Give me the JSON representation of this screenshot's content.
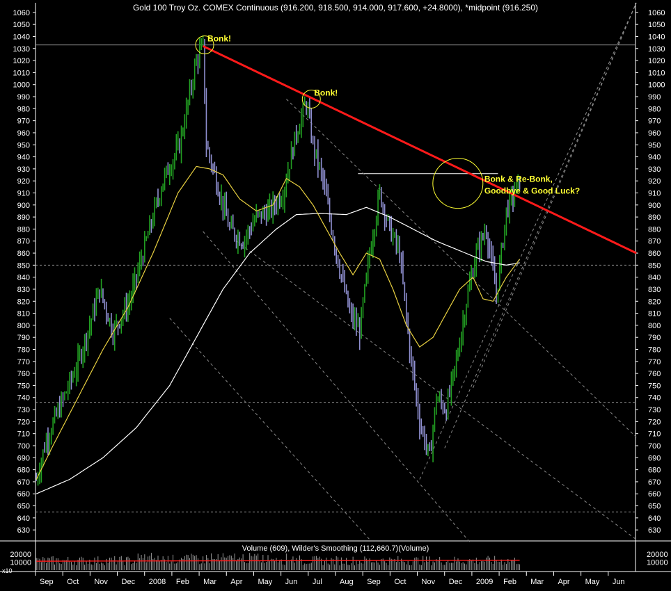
{
  "header": {
    "title": "Gold 100 Troy Oz. COMEX Continuous (916.200, 918.500, 914.000, 917.600, +24.8000), *midpoint (916.250)"
  },
  "colors": {
    "background": "#000000",
    "axis": "#ffffff",
    "up_bar": "#22a022",
    "down_bar": "#8f8fd0",
    "fast_ma": "#e8d040",
    "slow_ma": "#ffffff",
    "resistance": "#ff1a1a",
    "annotation": "#ffff33",
    "dashed": "#8a8a8a"
  },
  "chart_data": {
    "type": "bar",
    "title": "Gold 100 Troy Oz. COMEX Continuous (916.200, 918.500, 914.000, 917.600, +24.8000), *midpoint (916.250)",
    "ylim": [
      622,
      1068
    ],
    "y_ticks": [
      630,
      640,
      650,
      660,
      670,
      680,
      690,
      700,
      710,
      720,
      730,
      740,
      750,
      760,
      770,
      780,
      790,
      800,
      810,
      820,
      830,
      840,
      850,
      860,
      870,
      880,
      890,
      900,
      910,
      920,
      930,
      940,
      950,
      960,
      970,
      980,
      990,
      1000,
      1010,
      1020,
      1030,
      1040,
      1050,
      1060
    ],
    "x_labels": [
      "Sep",
      "Oct",
      "Nov",
      "Dec",
      "2008",
      "Feb",
      "Mar",
      "Apr",
      "May",
      "Jun",
      "Jul",
      "Aug",
      "Sep",
      "Oct",
      "Nov",
      "Dec",
      "2009",
      "Feb",
      "Mar",
      "Apr",
      "May",
      "Jun"
    ],
    "price_anchors": [
      [
        0,
        672
      ],
      [
        6,
        705
      ],
      [
        15,
        735
      ],
      [
        24,
        765
      ],
      [
        32,
        800
      ],
      [
        38,
        830
      ],
      [
        46,
        795
      ],
      [
        56,
        820
      ],
      [
        66,
        870
      ],
      [
        76,
        920
      ],
      [
        86,
        950
      ],
      [
        96,
        1020
      ],
      [
        100,
        1032
      ],
      [
        102,
        950
      ],
      [
        108,
        920
      ],
      [
        116,
        880
      ],
      [
        124,
        870
      ],
      [
        132,
        890
      ],
      [
        140,
        895
      ],
      [
        148,
        910
      ],
      [
        156,
        960
      ],
      [
        162,
        985
      ],
      [
        166,
        950
      ],
      [
        172,
        920
      ],
      [
        180,
        860
      ],
      [
        188,
        810
      ],
      [
        194,
        795
      ],
      [
        200,
        860
      ],
      [
        206,
        910
      ],
      [
        212,
        880
      ],
      [
        218,
        860
      ],
      [
        224,
        780
      ],
      [
        230,
        720
      ],
      [
        236,
        690
      ],
      [
        240,
        740
      ],
      [
        246,
        730
      ],
      [
        252,
        770
      ],
      [
        258,
        820
      ],
      [
        264,
        860
      ],
      [
        270,
        880
      ],
      [
        276,
        825
      ],
      [
        282,
        895
      ],
      [
        290,
        920
      ]
    ],
    "fast_ma_anchors": [
      [
        0,
        672
      ],
      [
        10,
        700
      ],
      [
        25,
        740
      ],
      [
        40,
        780
      ],
      [
        55,
        815
      ],
      [
        70,
        860
      ],
      [
        85,
        910
      ],
      [
        96,
        932
      ],
      [
        104,
        930
      ],
      [
        112,
        925
      ],
      [
        122,
        905
      ],
      [
        132,
        895
      ],
      [
        142,
        900
      ],
      [
        150,
        922
      ],
      [
        158,
        915
      ],
      [
        166,
        900
      ],
      [
        174,
        880
      ],
      [
        182,
        860
      ],
      [
        190,
        842
      ],
      [
        198,
        860
      ],
      [
        206,
        855
      ],
      [
        214,
        830
      ],
      [
        222,
        800
      ],
      [
        230,
        782
      ],
      [
        238,
        790
      ],
      [
        246,
        810
      ],
      [
        254,
        830
      ],
      [
        262,
        840
      ],
      [
        268,
        822
      ],
      [
        274,
        820
      ],
      [
        282,
        840
      ],
      [
        290,
        855
      ]
    ],
    "slow_ma_anchors": [
      [
        0,
        660
      ],
      [
        20,
        672
      ],
      [
        40,
        690
      ],
      [
        60,
        715
      ],
      [
        80,
        750
      ],
      [
        96,
        790
      ],
      [
        112,
        830
      ],
      [
        128,
        860
      ],
      [
        144,
        880
      ],
      [
        156,
        892
      ],
      [
        170,
        893
      ],
      [
        186,
        892
      ],
      [
        198,
        898
      ],
      [
        212,
        890
      ],
      [
        226,
        880
      ],
      [
        240,
        870
      ],
      [
        254,
        862
      ],
      [
        270,
        853
      ],
      [
        282,
        850
      ],
      [
        290,
        852
      ]
    ],
    "resistance_line": [
      [
        100,
        1032
      ],
      [
        360,
        860
      ]
    ],
    "horizontal_lines": [
      1033,
      850,
      736,
      645
    ],
    "short_lines": [
      {
        "y": 926,
        "x0": 193,
        "x1": 277
      }
    ],
    "dashed_lines": [
      [
        [
          150,
          988
        ],
        [
          360,
          707
        ]
      ],
      [
        [
          100,
          878
        ],
        [
          260,
          620
        ]
      ],
      [
        [
          80,
          806
        ],
        [
          200,
          622
        ]
      ],
      [
        [
          120,
          870
        ],
        [
          360,
          622
        ]
      ],
      [
        [
          230,
          672
        ],
        [
          360,
          1068
        ]
      ],
      [
        [
          245,
          698
        ],
        [
          360,
          1068
        ]
      ],
      [
        [
          262,
          748
        ],
        [
          360,
          1068
        ]
      ]
    ],
    "annotations": [
      {
        "text": "Bonk!",
        "x": 101,
        "y": 1033
      },
      {
        "text": "Bonk!",
        "x": 165,
        "y": 988
      },
      {
        "text": "Bonk & Re-Bonk,\nGoodbye & Good Luck?",
        "x": 283,
        "y": 918
      }
    ],
    "volume": {
      "title": "Volume (609), Wilder's Smoothing (112,660.7)(Volume)",
      "multiplier_label": "x10",
      "ylim": [
        0,
        28000
      ],
      "y_ticks": [
        10000,
        20000
      ],
      "smoothing_level": 11266
    }
  }
}
